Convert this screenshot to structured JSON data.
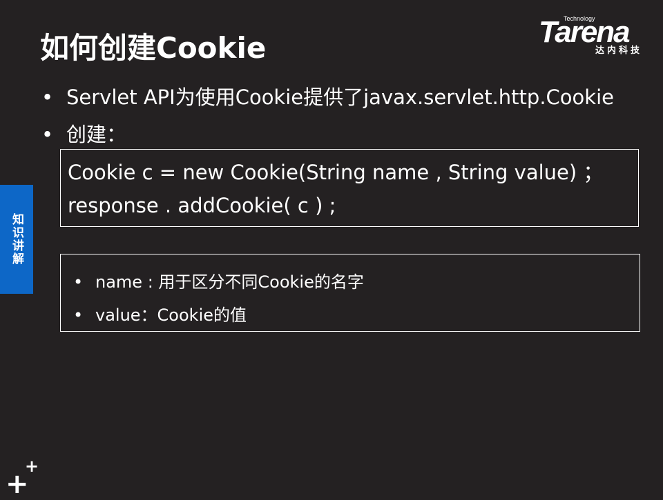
{
  "slide": {
    "title": "如何创建Cookie",
    "logo": {
      "tech": "Technology",
      "name": "Tarena",
      "sub": "达内科技"
    },
    "bullets": [
      "Servlet API为使用Cookie提供了javax.servlet.http.Cookie",
      "创建："
    ],
    "code": [
      "Cookie  c  = new Cookie(String name , String value) ；",
      "response . addCookie( c ) ;"
    ],
    "notes": [
      "name : 用于区分不同Cookie的名字",
      "value：Cookie的值"
    ],
    "side_tab": "知识讲解",
    "plus_big": "+",
    "plus_small": "+"
  },
  "colors": {
    "background": "#242122",
    "accent": "#0d67c7",
    "text": "#ffffff"
  },
  "icons": {
    "bullet": "bullet-dot-icon",
    "plus": "plus-mark-icon"
  }
}
